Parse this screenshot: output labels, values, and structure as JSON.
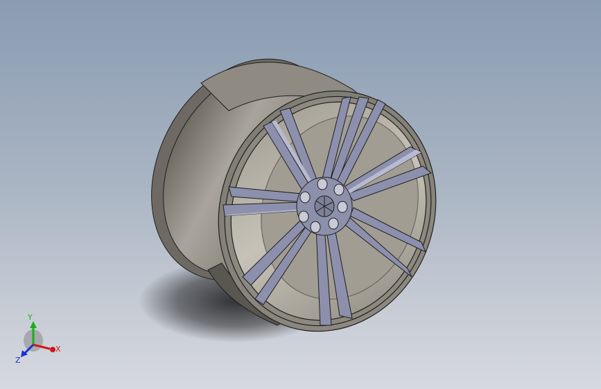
{
  "viewport": {
    "background_top": "#8a9cb2",
    "background_bottom": "#d6d9df"
  },
  "model": {
    "type": "wheel-rim",
    "rim_color": "#8a857b",
    "spoke_color": "#8c90ad",
    "edge_color": "#1e1e1e",
    "spoke_pairs": 7,
    "lug_holes": 6
  },
  "triad": {
    "x_label": "X",
    "y_label": "Y",
    "z_label": "Z",
    "x_color": "#d01818",
    "y_color": "#18b018",
    "z_color": "#1830d0"
  }
}
